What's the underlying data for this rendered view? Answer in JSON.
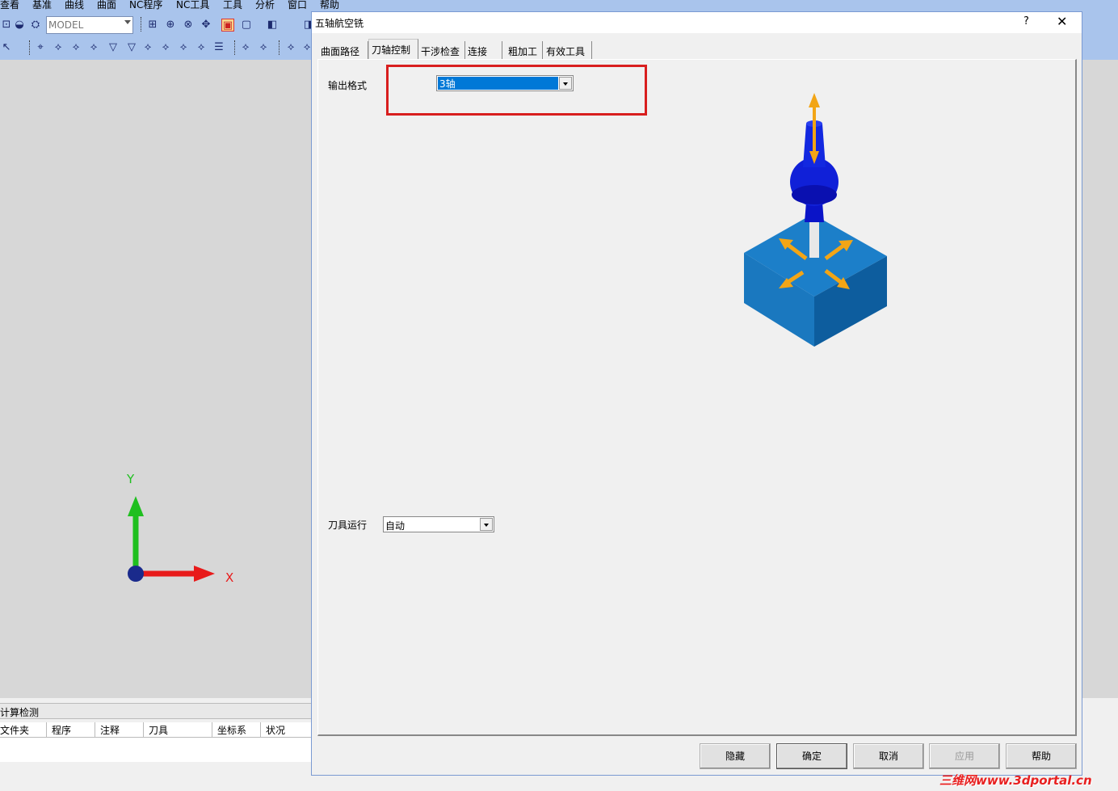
{
  "menubar": [
    "查看",
    "基准",
    "曲线",
    "曲面",
    "NC程序",
    "NC工具",
    "工具",
    "分析",
    "窗口",
    "帮助"
  ],
  "toolbar": {
    "model_combo": "MODEL"
  },
  "viewport": {
    "axis_y": "Y",
    "axis_x": "X"
  },
  "bottom_panel": {
    "title": "计算检测",
    "columns": [
      "文件夹",
      "程序",
      "注释",
      "刀具",
      "坐标系",
      "状况"
    ]
  },
  "dialog": {
    "title": "五轴航空铣",
    "help": "?",
    "close": "✕",
    "tabs": [
      "曲面路径",
      "刀轴控制",
      "干涉检查",
      "连接",
      "粗加工",
      "有效工具"
    ],
    "active_tab": 1,
    "output_format_label": "输出格式",
    "output_format_value": "3轴",
    "tool_run_label": "刀具运行",
    "tool_run_value": "自动",
    "buttons": {
      "hide": "隐藏",
      "ok": "确定",
      "cancel": "取消",
      "apply": "应用",
      "help": "帮助"
    }
  },
  "watermark": "三维网www.3dportal.cn",
  "colors": {
    "accent": "#d81e1e",
    "title_bar": "#a9c4ec",
    "selection": "#0078d7"
  }
}
